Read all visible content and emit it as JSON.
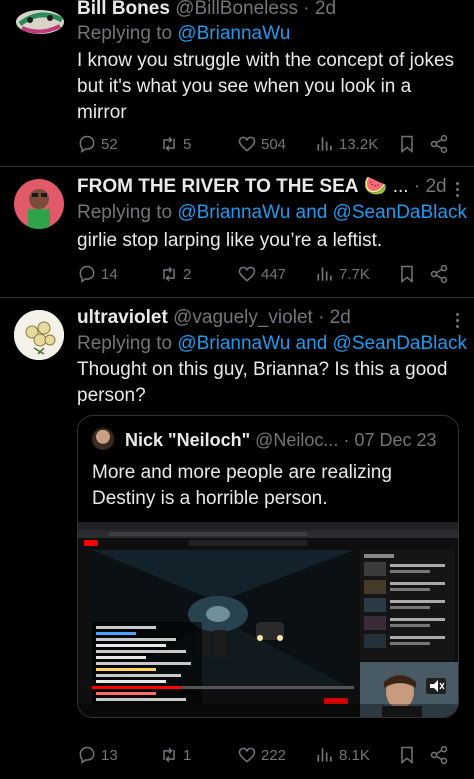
{
  "tweets": [
    {
      "name": "Bill Bones",
      "handle": "@BillBoneless",
      "time": "· 2d",
      "replying_prefix": "Replying to",
      "replying_to": "@BriannaWu",
      "body": "I know you struggle with the concept of jokes but it's what you see when you look in a mirror",
      "replies": "52",
      "reposts": "5",
      "likes": "504",
      "views": "13.2K"
    },
    {
      "name": "FROM THE RIVER TO THE SEA",
      "name_emoji": "🍉",
      "name_ellipsis": "...",
      "time": "· 2d",
      "replying_prefix": "Replying to",
      "replying_to": "@BriannaWu and @SeanDaBlack",
      "body": "girlie stop larping like you’re a leftist.",
      "replies": "14",
      "reposts": "2",
      "likes": "447",
      "views": "7.7K"
    },
    {
      "name": "ultraviolet",
      "handle": "@vaguely_violet",
      "time": "· 2d",
      "replying_prefix": "Replying to",
      "replying_to": "@BriannaWu and @SeanDaBlack",
      "body": "Thought on this guy, Brianna? Is this a good person?",
      "replies": "13",
      "reposts": "1",
      "likes": "222",
      "views": "8.1K",
      "quote": {
        "name": "Nick \"Neiloch\"",
        "handle": "@Neiloc...",
        "time": "· 07 Dec 23",
        "body": "More and more people are realizing Destiny is a horrible person."
      }
    }
  ],
  "colors": {
    "background": "#000000",
    "text": "#e7e9ea",
    "muted": "#71767b",
    "link": "#1d9bf0",
    "divider": "#2f3336"
  },
  "icons": [
    "reply-icon",
    "repost-icon",
    "like-icon",
    "views-icon",
    "bookmark-icon",
    "share-icon",
    "more-icon"
  ]
}
